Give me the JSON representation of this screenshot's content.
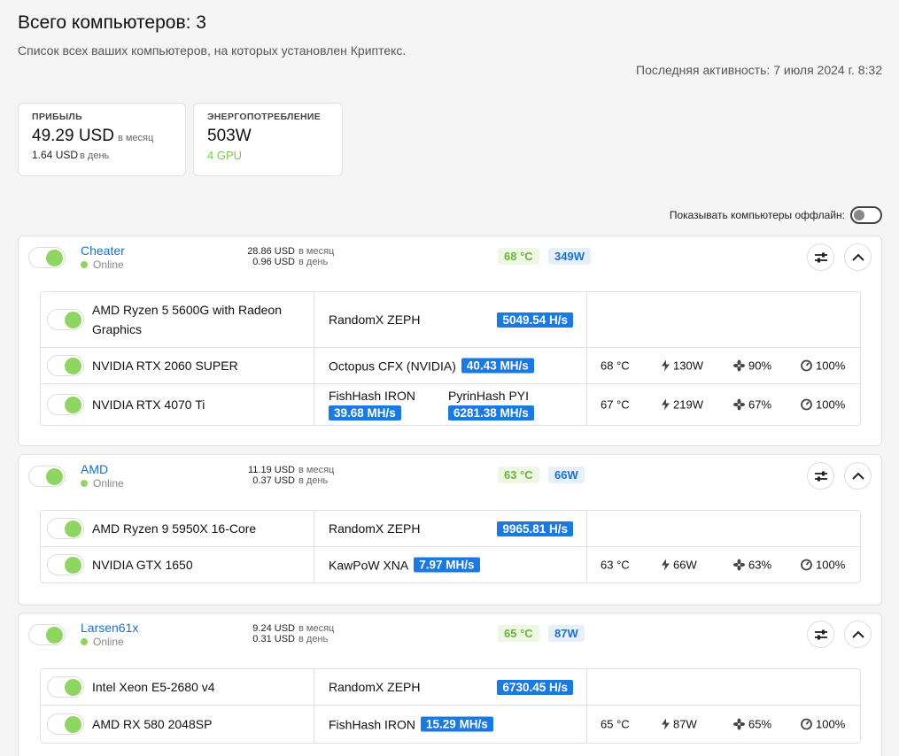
{
  "header": {
    "title": "Всего компьютеров: 3",
    "description": "Список всех ваших компьютеров, на которых установлен Криптекс.",
    "last_activity": "Последняя активность: 7 июля 2024 г. 8:32"
  },
  "stats": {
    "profit": {
      "label": "Прибыль",
      "monthly_value": "49.29 USD",
      "monthly_unit": "в месяц",
      "daily_value": "1.64 USD",
      "daily_unit": "в день"
    },
    "power": {
      "label": "Энергопотребление",
      "value": "503W",
      "gpu_count": "4 GPU"
    }
  },
  "offline_toggle": {
    "label": "Показывать компьютеры оффлайн:",
    "enabled": false
  },
  "colors": {
    "accent_blue": "#1a72c9",
    "hash_badge": "#1a7ae0",
    "online_green": "#8fd561",
    "temp_green": "#6ab434"
  },
  "machines": [
    {
      "name": "Cheater",
      "status": "Online",
      "monthly": "28.86 USD",
      "monthly_unit": "в месяц",
      "daily": "0.96 USD",
      "daily_unit": "в день",
      "temp": "68 °C",
      "power": "349W",
      "devices": [
        {
          "name": "AMD Ryzen 5 5600G with Radeon Graphics",
          "algos": [
            {
              "label": "RandomX ZEPH",
              "hash": "5049.54 H/s"
            }
          ]
        },
        {
          "name": "NVIDIA RTX 2060 SUPER",
          "algos": [
            {
              "label": "Octopus CFX (NVIDIA)",
              "hash": "40.43 MH/s"
            }
          ],
          "temp": "68 °C",
          "power": "130W",
          "fan": "90%",
          "load": "100%"
        },
        {
          "name": "NVIDIA RTX 4070 Ti",
          "algos": [
            {
              "label": "FishHash IRON",
              "hash": "39.68 MH/s"
            },
            {
              "label": "PyrinHash PYI",
              "hash": "6281.38 MH/s"
            }
          ],
          "temp": "67 °C",
          "power": "219W",
          "fan": "67%",
          "load": "100%"
        }
      ]
    },
    {
      "name": "AMD",
      "status": "Online",
      "monthly": "11.19 USD",
      "monthly_unit": "в месяц",
      "daily": "0.37 USD",
      "daily_unit": "в день",
      "temp": "63 °C",
      "power": "66W",
      "devices": [
        {
          "name": "AMD Ryzen 9 5950X 16-Core",
          "algos": [
            {
              "label": "RandomX ZEPH",
              "hash": "9965.81 H/s"
            }
          ]
        },
        {
          "name": "NVIDIA GTX 1650",
          "algos": [
            {
              "label": "KawPoW XNA",
              "hash": "7.97 MH/s"
            }
          ],
          "temp": "63 °C",
          "power": "66W",
          "fan": "63%",
          "load": "100%"
        }
      ]
    },
    {
      "name": "Larsen61x",
      "status": "Online",
      "monthly": "9.24 USD",
      "monthly_unit": "в месяц",
      "daily": "0.31 USD",
      "daily_unit": "в день",
      "temp": "65 °C",
      "power": "87W",
      "devices": [
        {
          "name": "Intel Xeon E5-2680 v4",
          "algos": [
            {
              "label": "RandomX ZEPH",
              "hash": "6730.45 H/s"
            }
          ]
        },
        {
          "name": "AMD RX 580 2048SP",
          "algos": [
            {
              "label": "FishHash IRON",
              "hash": "15.29 MH/s"
            }
          ],
          "temp": "65 °C",
          "power": "87W",
          "fan": "65%",
          "load": "100%"
        }
      ]
    }
  ]
}
